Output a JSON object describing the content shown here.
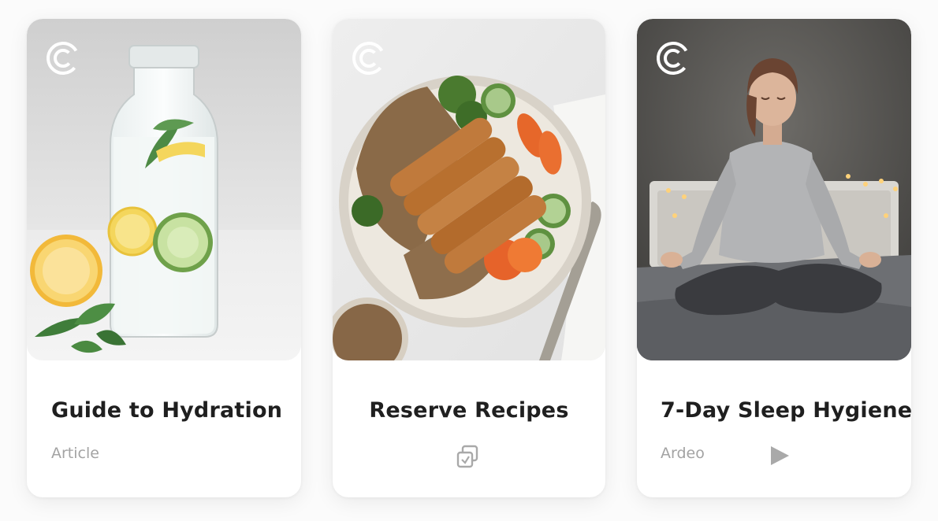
{
  "cards": [
    {
      "title": "Guide to Hydration",
      "meta": "Article",
      "image": "infused-water-bottle-lemon-cucumber-mint",
      "logo_icon": "brand-c-logo-icon"
    },
    {
      "title": "Reserve Recipes",
      "meta_icon": "recipe-cards-icon",
      "image": "quinoa-chicken-vegetable-bowl",
      "logo_icon": "brand-c-logo-icon"
    },
    {
      "title": "7-Day Sleep Hygiene",
      "meta": "Ardeo",
      "meta_icon": "play-icon",
      "image": "woman-meditating-on-bed",
      "logo_icon": "brand-c-logo-icon"
    }
  ],
  "colors": {
    "title": "#1f1f1f",
    "meta": "#a3a3a3",
    "icon": "#a9a9a9",
    "card_background": "#ffffff"
  }
}
